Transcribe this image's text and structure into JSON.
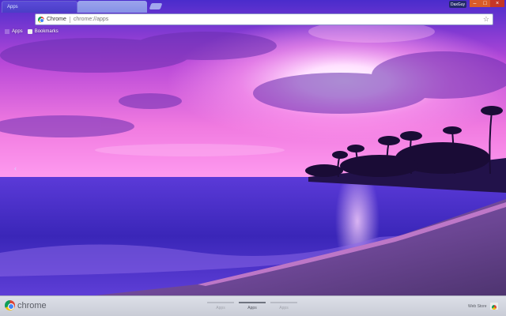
{
  "window": {
    "tab_title": "Apps",
    "profile_name": "DaxGuy",
    "minimize_glyph": "–",
    "maximize_glyph": "□",
    "close_glyph": "×"
  },
  "omnibox": {
    "origin": "Chrome",
    "url": "chrome://apps",
    "star_glyph": "☆"
  },
  "bookmarks_bar": {
    "apps_label": "Apps",
    "bookmarks_label": "Bookmarks"
  },
  "content": {
    "prev_page_glyph": "‹"
  },
  "bottom_bar": {
    "logo_text": "chrome",
    "pages": [
      {
        "label": "Apps",
        "active": false
      },
      {
        "label": "Apps",
        "active": true
      },
      {
        "label": "Apps",
        "active": false
      }
    ],
    "web_store_label": "Web Store"
  },
  "colors": {
    "tab_active": "#4a3ec6",
    "close_button": "#c53626",
    "bottom_bar": "#d4d7e0"
  }
}
